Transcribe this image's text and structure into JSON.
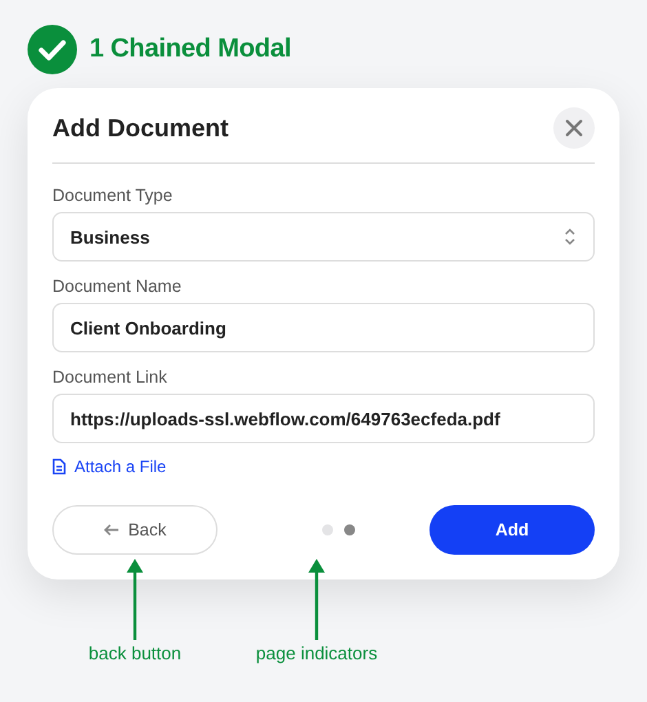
{
  "heading": {
    "text": "1 Chained Modal",
    "done": true
  },
  "modal": {
    "title": "Add Document",
    "fields": [
      {
        "kind": "select",
        "label": "Document Type",
        "value": "Business"
      },
      {
        "kind": "text",
        "label": "Document Name",
        "value": "Client Onboarding"
      },
      {
        "kind": "text",
        "label": "Document Link",
        "value": "https://uploads-ssl.webflow.com/649763ecfeda.pdf"
      }
    ],
    "attach_link": "Attach a File",
    "back_button": "Back",
    "pages": [
      {
        "selected": false
      },
      {
        "selected": true
      }
    ],
    "add_button": "Add"
  },
  "annotations": [
    {
      "text": "back button"
    },
    {
      "text": "page indicators"
    }
  ]
}
